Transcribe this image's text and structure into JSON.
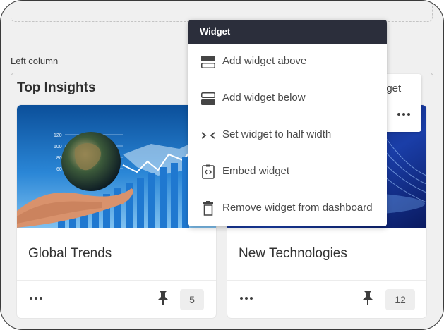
{
  "left_column": {
    "label": "Left column"
  },
  "section": {
    "title": "Top Insights"
  },
  "cards": [
    {
      "title": "Global Trends",
      "count": "5"
    },
    {
      "title": "New Technologies",
      "count": "12"
    }
  ],
  "card2_bar": {
    "partial_text": "dget"
  },
  "context_menu": {
    "header": "Widget",
    "items": [
      {
        "label": "Add widget above",
        "icon": "add-above-icon"
      },
      {
        "label": "Add widget below",
        "icon": "add-below-icon"
      },
      {
        "label": "Set widget to half width",
        "icon": "half-width-icon"
      },
      {
        "label": "Embed widget",
        "icon": "embed-icon"
      },
      {
        "label": "Remove widget from dashboard",
        "icon": "trash-icon"
      }
    ]
  },
  "colors": {
    "menu_header_bg": "#2b2e3b",
    "background": "#f0f0f0"
  }
}
